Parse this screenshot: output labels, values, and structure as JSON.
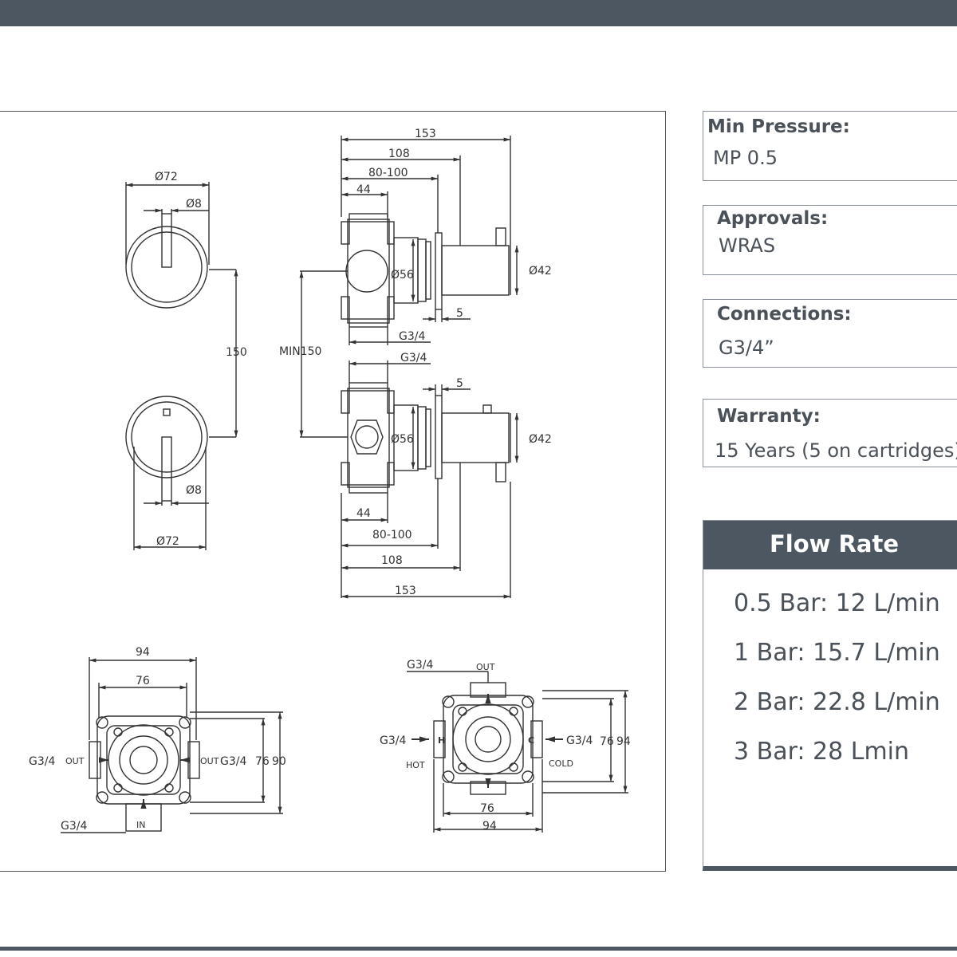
{
  "specs": {
    "min_pressure": {
      "label": "Min Pressure:",
      "value": "MP 0.5"
    },
    "approvals": {
      "label": "Approvals:",
      "value": "WRAS"
    },
    "connections": {
      "label": "Connections:",
      "value": "G3/4”"
    },
    "warranty": {
      "label": "Warranty:",
      "value": "15 Years (5 on cartridges)"
    }
  },
  "flow_rate": {
    "title": "Flow Rate",
    "rows": [
      "0.5 Bar: 12 L/min",
      "1 Bar: 15.7 L/min",
      "2 Bar: 22.8 L/min",
      "3 Bar: 28 Lmin"
    ]
  },
  "drawing": {
    "front": {
      "d72_top": "Ø72",
      "d8_top": "Ø8",
      "spacing": "150",
      "d8_bottom": "Ø8",
      "d72_bottom": "Ø72"
    },
    "side_top": {
      "d153": "153",
      "d108": "108",
      "d80_100": "80-100",
      "d44": "44",
      "d56": "Ø56",
      "d42": "Ø42",
      "d5": "5",
      "g34": "G3/4"
    },
    "min150": "MIN150",
    "side_bottom": {
      "g34": "G3/4",
      "d5": "5",
      "d56": "Ø56",
      "d42": "Ø42",
      "d44": "44",
      "d80_100": "80-100",
      "d108": "108",
      "d153": "153"
    },
    "plan_left": {
      "d94": "94",
      "d76": "76",
      "g34_left": "G3/4",
      "out_left": "OUT",
      "out_right": "OUT",
      "g34_right": "G3/4",
      "d76v": "76",
      "d90": "90",
      "g34_bottom": "G3/4",
      "in": "IN"
    },
    "plan_right": {
      "g34_top": "G3/4",
      "out": "OUT",
      "g34_left": "G3/4",
      "h": "H",
      "hot": "HOT",
      "c": "C",
      "g34_right": "G3/4",
      "cold": "COLD",
      "d76v": "76",
      "d94v": "94",
      "d76": "76",
      "d94": "94"
    }
  }
}
